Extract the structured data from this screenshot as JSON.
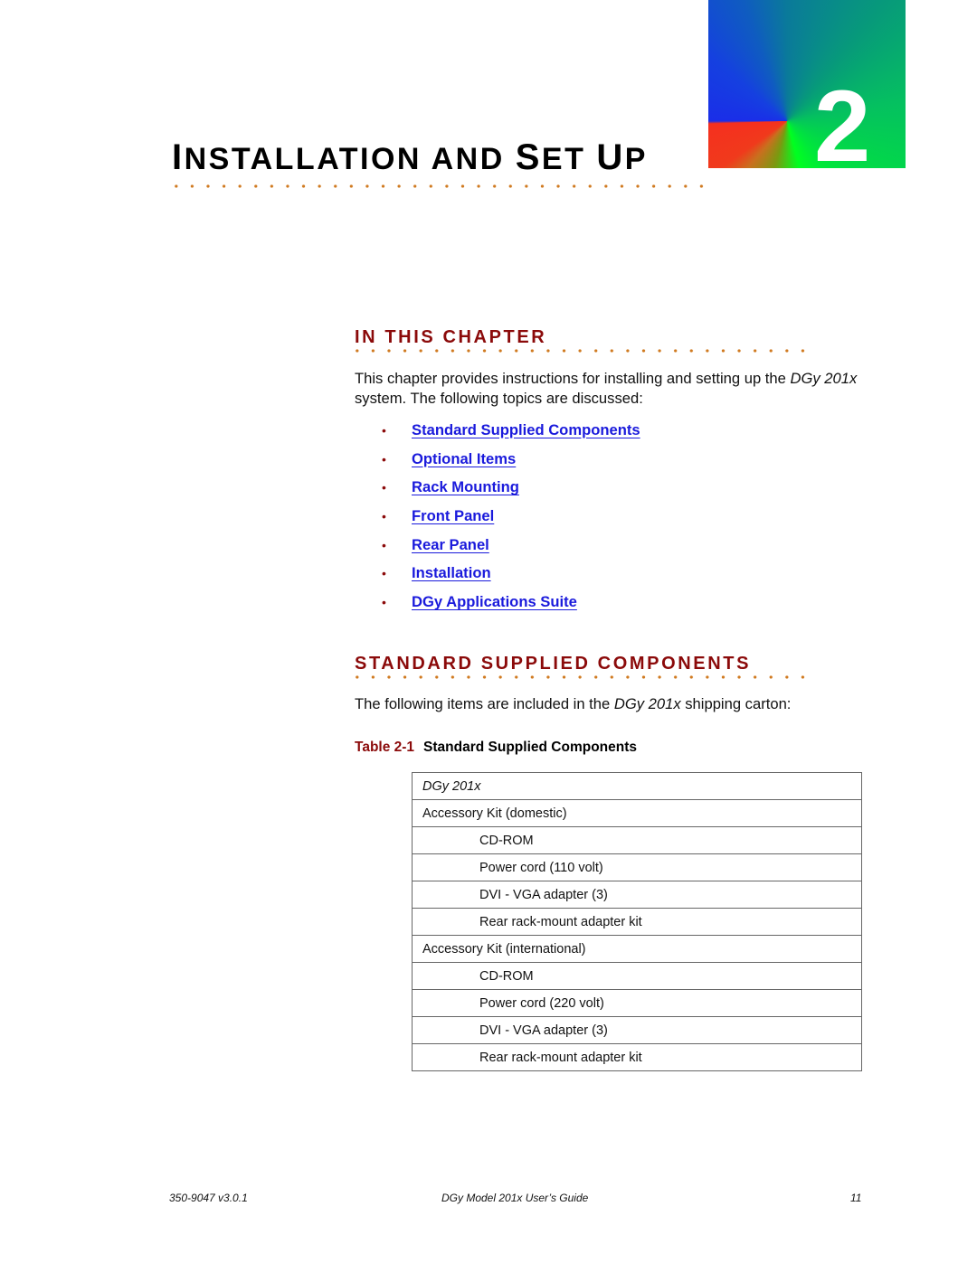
{
  "chapter": {
    "number": "2",
    "title_parts": [
      {
        "big": "I",
        "small": "NSTALLATION AND "
      },
      {
        "big": "S",
        "small": "ET "
      },
      {
        "big": "U",
        "small": "P"
      }
    ],
    "badge_colors": [
      "#1a2ee8",
      "#f5301e",
      "#00ff20",
      "#0a7a9a"
    ]
  },
  "accent_colors": {
    "heading": "#8b0a0a",
    "dots": "#d07a20",
    "link": "#1a1adc"
  },
  "in_this_chapter": {
    "heading": "IN THIS CHAPTER",
    "intro_pre": "This chapter provides instructions for installing and setting up the ",
    "intro_em": "DGy 201x",
    "intro_post": " system. The following topics are discussed:",
    "bullet": "•",
    "topics": [
      "Standard Supplied Components",
      "Optional Items",
      "Rack Mounting",
      "Front Panel",
      "Rear Panel",
      "Installation",
      "DGy Applications Suite"
    ]
  },
  "standard_components": {
    "heading": "STANDARD SUPPLIED COMPONENTS",
    "intro_pre": "The following items are included in the ",
    "intro_em": "DGy 201x",
    "intro_post": " shipping carton:",
    "table_label": "Table 2-1",
    "table_title": "Standard Supplied Components",
    "rows": [
      {
        "text": "DGy 201x",
        "level": "header"
      },
      {
        "text": "Accessory Kit (domestic)",
        "level": "group"
      },
      {
        "text": "CD-ROM",
        "level": "item"
      },
      {
        "text": "Power cord (110 volt)",
        "level": "item"
      },
      {
        "text": "DVI - VGA adapter (3)",
        "level": "item"
      },
      {
        "text": "Rear rack-mount adapter kit",
        "level": "item"
      },
      {
        "text": "Accessory Kit (international)",
        "level": "group"
      },
      {
        "text": "CD-ROM",
        "level": "item"
      },
      {
        "text": "Power cord (220 volt)",
        "level": "item"
      },
      {
        "text": "DVI - VGA adapter (3)",
        "level": "item"
      },
      {
        "text": "Rear rack-mount adapter kit",
        "level": "item"
      }
    ]
  },
  "footer": {
    "doc_number": "350-9047 v3.0.1",
    "doc_title": "DGy Model 201x User’s Guide",
    "page_number": "11"
  }
}
